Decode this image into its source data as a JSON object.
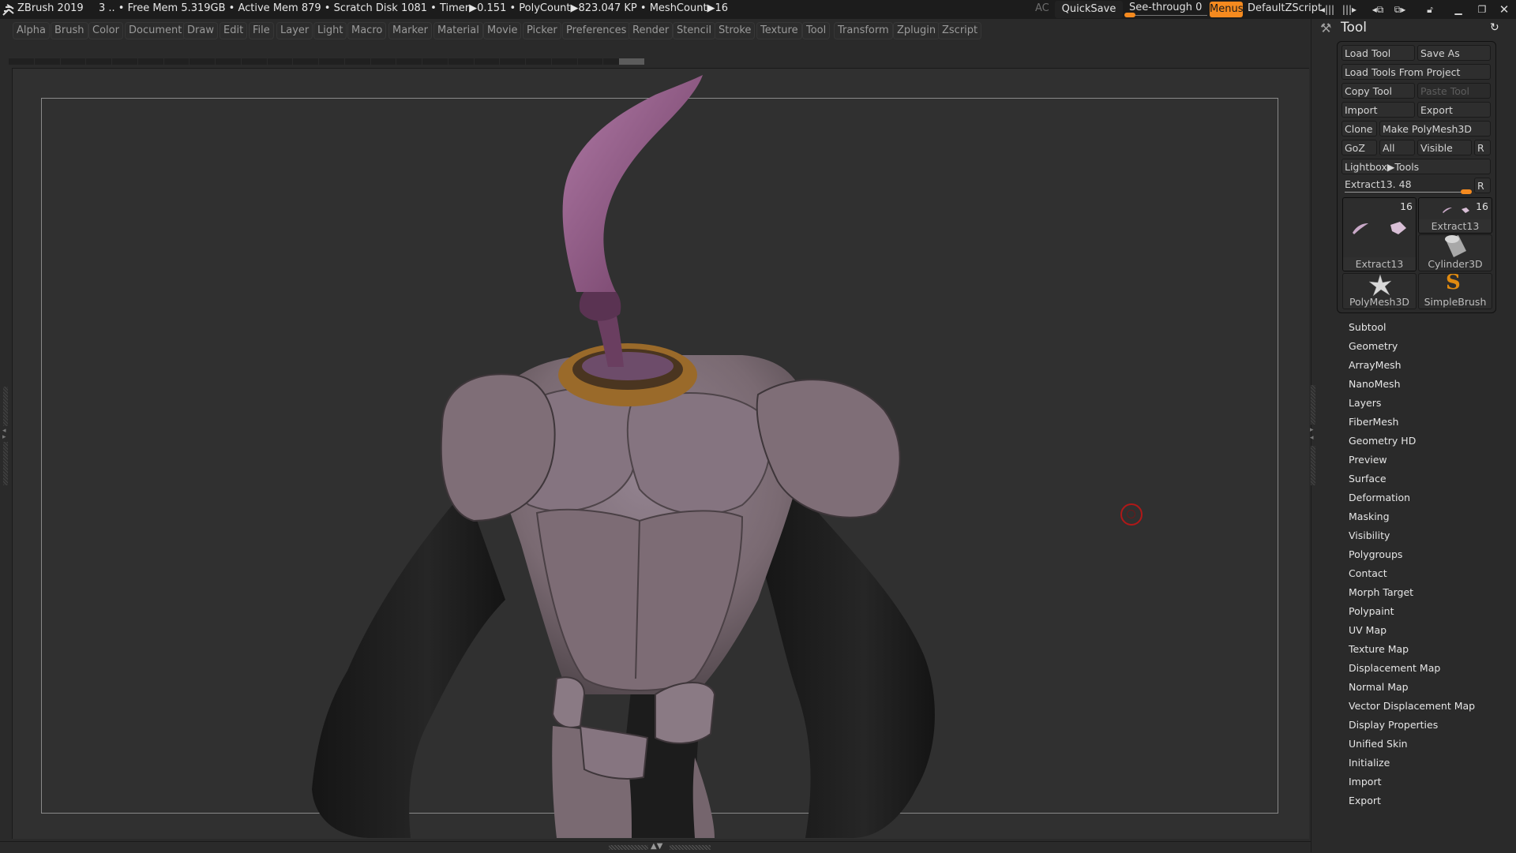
{
  "titlebar": {
    "app_title": "ZBrush 2019",
    "status": "3   .. • Free Mem 5.319GB • Active Mem 879 • Scratch Disk 1081 •  Timer▶0.151 • PolyCount▶823.047 KP  • MeshCount▶16",
    "ac_label": "AC",
    "quicksave_label": "QuickSave",
    "seethrough_label": "See-through  0",
    "seethrough_value": 0,
    "menus_label": "Menus",
    "default_zscript_label": "DefaultZScript",
    "window_icons": [
      "scroll-left-icon",
      "scroll-right-icon",
      "prev-layout-icon",
      "next-layout-icon",
      "unlock-icon",
      "minimize-icon",
      "restore-icon",
      "close-icon"
    ]
  },
  "menubar": {
    "items": [
      "Alpha",
      "Brush",
      "Color",
      "Document",
      "Draw",
      "Edit",
      "File",
      "Layer",
      "Light",
      "Macro",
      "Marker",
      "Material",
      "Movie",
      "Picker",
      "Preferences",
      "Render",
      "Stencil",
      "Stroke",
      "Texture",
      "Tool",
      "Transform",
      "Zplugin",
      "Zscript"
    ]
  },
  "timeline": {
    "segments": 24
  },
  "tool_palette": {
    "title": "Tool",
    "buttons": {
      "load_tool": "Load Tool",
      "save_as": "Save As",
      "load_tools_from_project": "Load Tools From Project",
      "copy_tool": "Copy Tool",
      "paste_tool": "Paste Tool",
      "import": "Import",
      "export": "Export",
      "clone": "Clone",
      "make_polymesh3d": "Make PolyMesh3D",
      "goz": "GoZ",
      "all": "All",
      "visible": "Visible",
      "r": "R",
      "lightbox_tools": "Lightbox▶Tools",
      "slider_r": "R"
    },
    "current_tool_slider": {
      "label": "Extract13. 48",
      "value": 48
    },
    "thumbnails": [
      {
        "label": "Extract13",
        "count": "16",
        "icon": "extract-mesh-icon"
      },
      {
        "label": "Extract13",
        "count": "16",
        "icon": "extract-mesh-small-icon"
      },
      {
        "label": "Cylinder3D",
        "icon": "cylinder-icon"
      },
      {
        "label": "PolyMesh3D",
        "icon": "star-polymesh-icon"
      },
      {
        "label": "SimpleBrush",
        "icon": "simplebrush-s-icon"
      }
    ],
    "subpalettes": [
      "Subtool",
      "Geometry",
      "ArrayMesh",
      "NanoMesh",
      "Layers",
      "FiberMesh",
      "Geometry HD",
      "Preview",
      "Surface",
      "Deformation",
      "Masking",
      "Visibility",
      "Polygroups",
      "Contact",
      "Morph Target",
      "Polypaint",
      "UV Map",
      "Texture Map",
      "Displacement Map",
      "Normal Map",
      "Vector Displacement Map",
      "Display Properties",
      "Unified Skin",
      "Initialize",
      "Import",
      "Export"
    ]
  },
  "colors": {
    "accent": "#f58a1f",
    "cursor": "#b01818",
    "skin": "#7e6c74",
    "horn": "#8a4f7a",
    "ring": "#9a6a2a",
    "dark_limb": "#1d1d1d"
  }
}
